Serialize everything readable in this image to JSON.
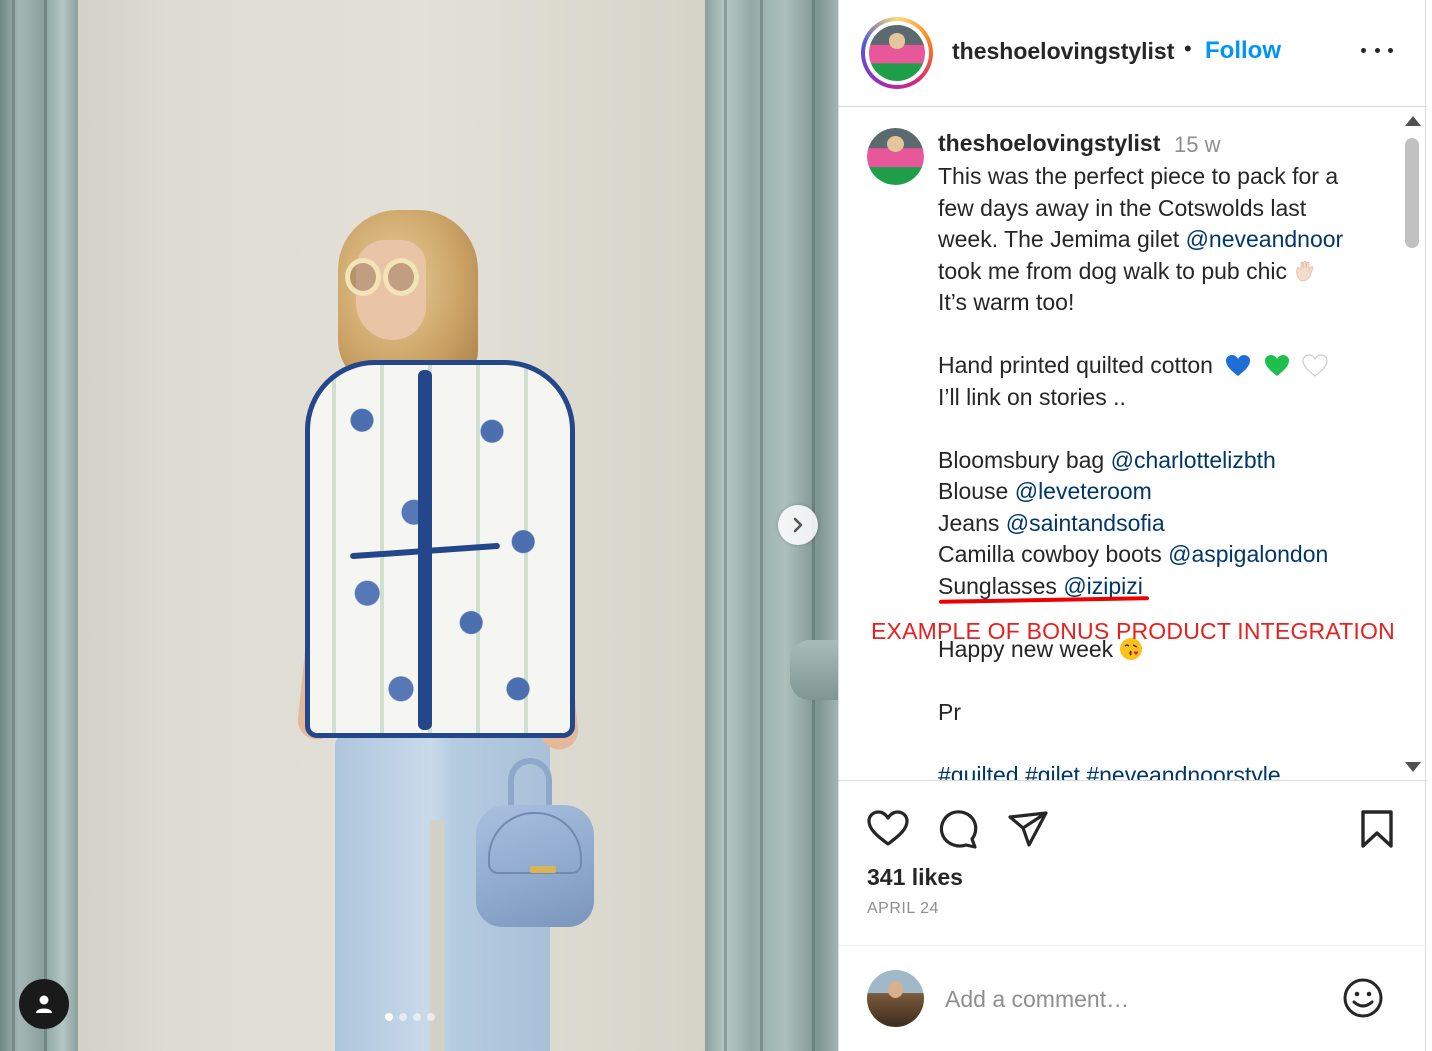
{
  "post": {
    "username": "theshoelovingstylist",
    "follow_label": "Follow",
    "time_ago": "15 w",
    "likes": "341 likes",
    "date": "APRIL 24",
    "carousel": {
      "total": 4,
      "active_index": 0
    }
  },
  "caption": {
    "l1": "This was the perfect piece to pack for a",
    "l2": "few days away in the Cotswolds last",
    "l3a": "week. The Jemima gilet ",
    "l3b": "@neveandnoor",
    "l4": "took me from dog walk to pub chic",
    "l5": "It’s warm too!",
    "l6": "Hand printed quilted cotton",
    "l7": "I’ll link on stories ..",
    "l8a": "Bloomsbury bag ",
    "l8b": "@charlottelizbth",
    "l9a": "Blouse ",
    "l9b": "@leveteroom",
    "l10a": "Jeans ",
    "l10b": "@saintandsofia",
    "l11a": "Camilla cowboy boots ",
    "l11b": "@aspigalondon",
    "l12a": "Sunglasses ",
    "l12b": "@izipizi",
    "l13": "Happy new week",
    "l14": "Pr",
    "l15": "#quilted #gilet #neveandnoorstyle",
    "annotation": "EXAMPLE OF BONUS PRODUCT INTEGRATION"
  },
  "comment": {
    "placeholder": "Add a comment…"
  },
  "colors": {
    "follow": "#0095f6",
    "mention": "#00376b",
    "annotation": "#e8201e",
    "muted": "#8e8e8e"
  },
  "icons": [
    "next-arrow-icon",
    "user-tag-icon",
    "more-options-icon",
    "heart-icon",
    "comment-icon",
    "share-icon",
    "bookmark-icon",
    "emoji-smiley-icon",
    "waving-hand-emoji",
    "blue-heart-emoji",
    "green-heart-emoji",
    "white-heart-emoji",
    "kissing-face-emoji"
  ]
}
